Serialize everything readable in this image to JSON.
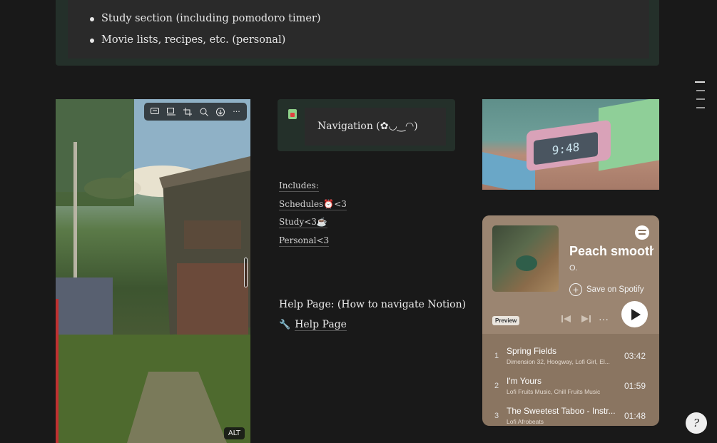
{
  "top_callout": {
    "bullets": [
      "Study section (including pomodoro timer)",
      "Movie lists, recipes, etc. (personal)"
    ]
  },
  "image_left": {
    "toolbar": [
      "comment-icon",
      "caption-icon",
      "crop-icon",
      "zoom-icon",
      "download-icon",
      "more-icon"
    ],
    "more_label": "···",
    "alt_label": "ALT"
  },
  "navigation": {
    "title": "Navigation (✿◡‿◠)",
    "includes_label": "Includes:",
    "links": [
      "Schedules⏰<3",
      "Study<3☕",
      "Personal<3"
    ]
  },
  "help": {
    "heading": "Help Page: (How to navigate Notion)",
    "link_label": "Help Page",
    "link_icon": "wrench-icon"
  },
  "clock_image": {
    "display": "9:48"
  },
  "spotify": {
    "title": "Peach smoothie",
    "artist": "O.",
    "save_label": "Save on Spotify",
    "preview_label": "Preview",
    "more_label": "···",
    "tracks": [
      {
        "num": "1",
        "name": "Spring Fields",
        "artists": "Dimension 32, Hoogway, Lofi Girl, El...",
        "duration": "03:42"
      },
      {
        "num": "2",
        "name": "I'm Yours",
        "artists": "Lofi Fruits Music, Chill Fruits Music",
        "duration": "01:59"
      },
      {
        "num": "3",
        "name": "The Sweetest Taboo - Instr...",
        "artists": "Lofi Afrobeats",
        "duration": "01:48"
      }
    ]
  },
  "help_fab": {
    "label": "?"
  }
}
